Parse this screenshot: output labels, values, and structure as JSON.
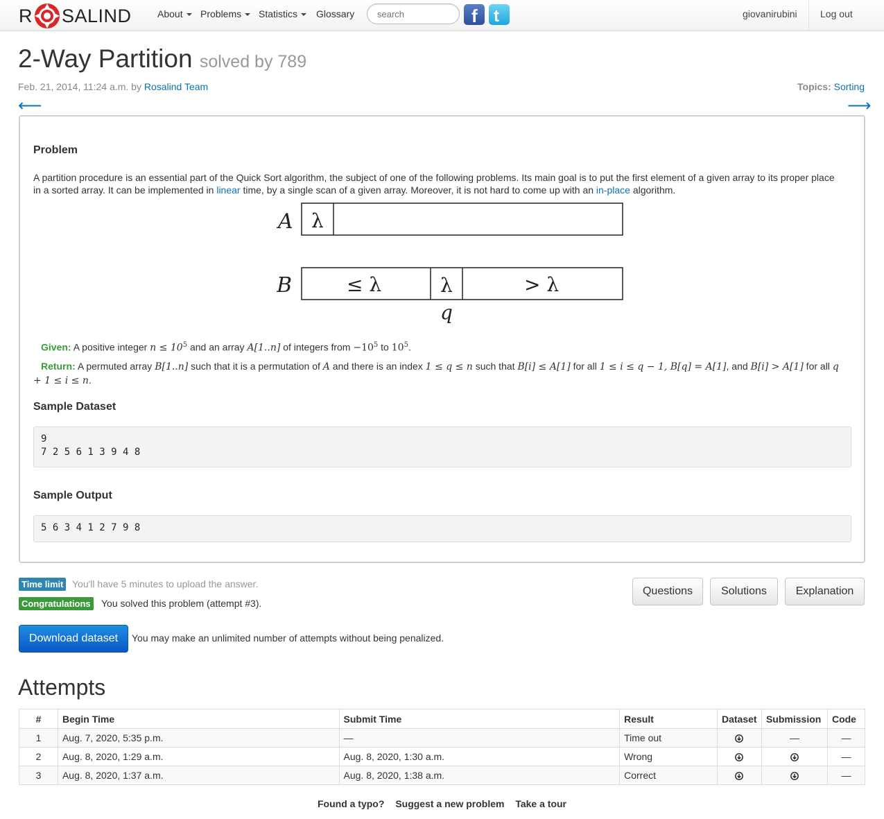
{
  "nav": {
    "brand_left": "R",
    "brand_right": "SALIND",
    "about": "About",
    "problems": "Problems",
    "statistics": "Statistics",
    "glossary": "Glossary",
    "search_placeholder": "search",
    "facebook_icon": "facebook-icon",
    "twitter_icon": "twitter-icon",
    "username": "giovanirubini",
    "logout": "Log out"
  },
  "header": {
    "title": "2-Way Partition",
    "solved_by": "solved by 789",
    "date": "Feb. 21, 2014, 11:24 a.m. by ",
    "author": "Rosalind Team",
    "topics_label": "Topics:",
    "topic": "Sorting",
    "prev_arrow": "⟵",
    "next_arrow": "⟶"
  },
  "problem": {
    "heading": "Problem",
    "para_1": "A partition procedure is an essential part of the Quick Sort algorithm, the subject of one of the following problems. Its main goal is to put the first element of a given array to its proper place in a sorted array. It can be implemented in ",
    "link_linear": "linear",
    "para_2": " time, by a single scan of a given array. Moreover, it is not hard to come up with an ",
    "link_inplace": "in-place",
    "para_3": " algorithm.",
    "diagram": {
      "label_a": "A",
      "label_b": "B",
      "lambda": "λ",
      "leq_lambda": "≤ λ",
      "gt_lambda": "> λ",
      "q": "q"
    },
    "given_label": "Given:",
    "given_text_1": "A positive integer ",
    "given_math_1": "n ≤ 10",
    "given_sup_1": "5",
    "given_text_2": " and an array ",
    "given_math_2": "A[1..n]",
    "given_text_3": " of integers from ",
    "given_math_3": "−10",
    "given_sup_3": "5",
    "given_text_4": " to ",
    "given_math_4": "10",
    "given_sup_4": "5",
    "given_text_5": ".",
    "return_label": "Return:",
    "return_text_1": "A permuted array ",
    "return_math_1": "B[1..n]",
    "return_text_2": " such that it is a permutation of ",
    "return_math_2": "A",
    "return_text_3": " and there is an index ",
    "return_math_3": "1 ≤ q ≤ n",
    "return_text_4": " such that ",
    "return_math_4": "B[i] ≤ A[1]",
    "return_text_5": " for all ",
    "return_math_5": "1 ≤ i ≤ q − 1, B[q] = A[1]",
    "return_text_6": ", and ",
    "return_math_6": "B[i] > A[1]",
    "return_text_7": " for all ",
    "return_math_7": "q + 1 ≤ i ≤ n",
    "return_text_8": ".",
    "sample_dataset_heading": "Sample Dataset",
    "sample_dataset": "9\n7 2 5 6 1 3 9 4 8",
    "sample_output_heading": "Sample Output",
    "sample_output": "5 6 3 4 1 2 7 9 8"
  },
  "status": {
    "time_limit_badge": "Time limit",
    "time_limit_text": "You'll have 5 minutes to upload the answer.",
    "congrats_badge": "Congratulations",
    "congrats_text": "You solved this problem (attempt #3).",
    "download_button": "Download dataset",
    "attempts_note": "You may make an unlimited number of attempts without being penalized."
  },
  "buttons": {
    "questions": "Questions",
    "solutions": "Solutions",
    "explanation": "Explanation"
  },
  "attempts": {
    "heading": "Attempts",
    "columns": [
      "#",
      "Begin Time",
      "Submit Time",
      "Result",
      "Dataset",
      "Submission",
      "Code"
    ],
    "rows": [
      {
        "num": "1",
        "begin": "Aug. 7, 2020, 5:35 p.m.",
        "submit": "—",
        "result": "Time out",
        "dataset": "download-icon",
        "submission": "—",
        "code": "—"
      },
      {
        "num": "2",
        "begin": "Aug. 8, 2020, 1:29 a.m.",
        "submit": "Aug. 8, 2020, 1:30 a.m.",
        "result": "Wrong",
        "dataset": "download-icon",
        "submission": "download-icon",
        "code": "—"
      },
      {
        "num": "3",
        "begin": "Aug. 8, 2020, 1:37 a.m.",
        "submit": "Aug. 8, 2020, 1:38 a.m.",
        "result": "Correct",
        "dataset": "download-icon",
        "submission": "download-icon",
        "code": "—"
      }
    ]
  },
  "footer": {
    "typo": "Found a typo?",
    "suggest": "Suggest a new problem",
    "tour": "Take a tour"
  },
  "colors": {
    "link": "#0a72b8",
    "given_green": "#3a9a3a",
    "badge_blue": "#2f86b3",
    "badge_green": "#3a9a3a",
    "primary_button": "#0a58c6"
  }
}
